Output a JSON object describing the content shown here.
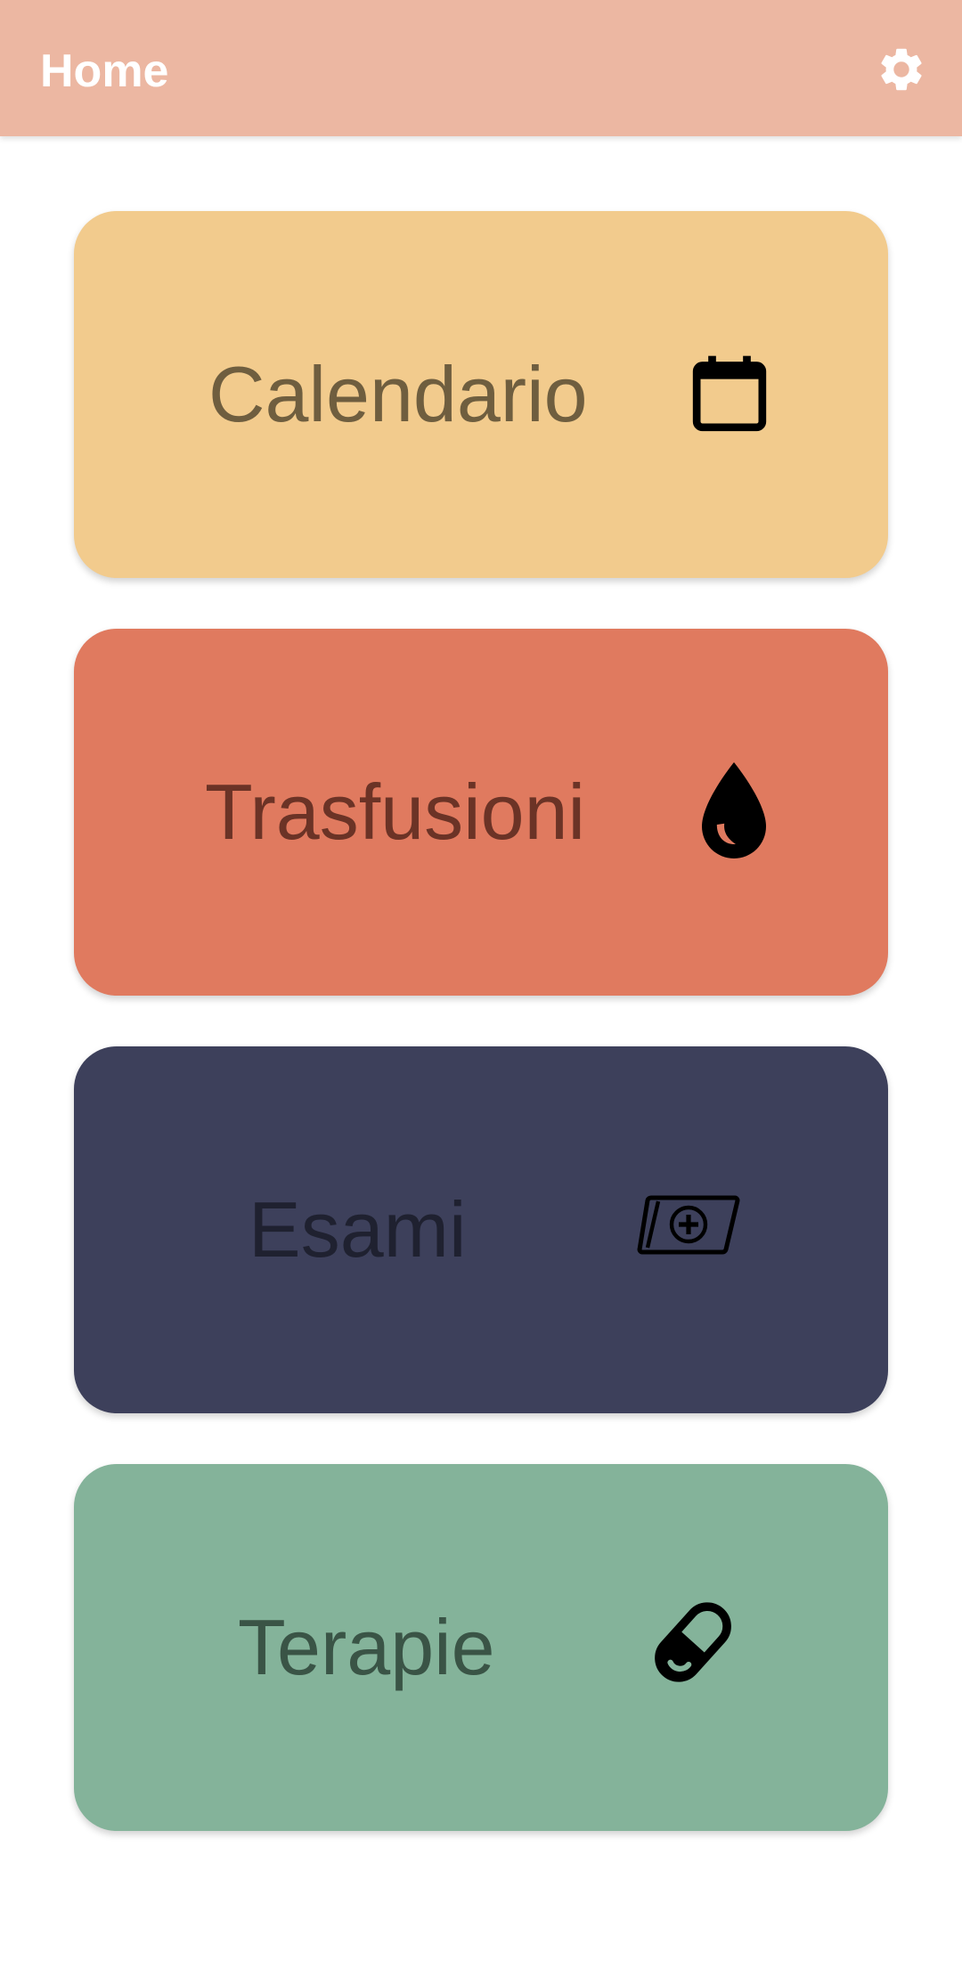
{
  "app_bar": {
    "title": "Home",
    "background_color": "#ECB7A2",
    "settings_icon": "gear-icon"
  },
  "cards": [
    {
      "label": "Calendario",
      "icon": "calendar-icon",
      "background_color": "#F2CB8D",
      "text_color": "#6F5E3F"
    },
    {
      "label": "Trasfusioni",
      "icon": "blood-drop-icon",
      "background_color": "#E07A5F",
      "text_color": "#6B3326"
    },
    {
      "label": "Esami",
      "icon": "medical-card-icon",
      "background_color": "#3D405B",
      "text_color": "#1F2130"
    },
    {
      "label": "Terapie",
      "icon": "pill-icon",
      "background_color": "#84B39A",
      "text_color": "#3A5446"
    }
  ]
}
